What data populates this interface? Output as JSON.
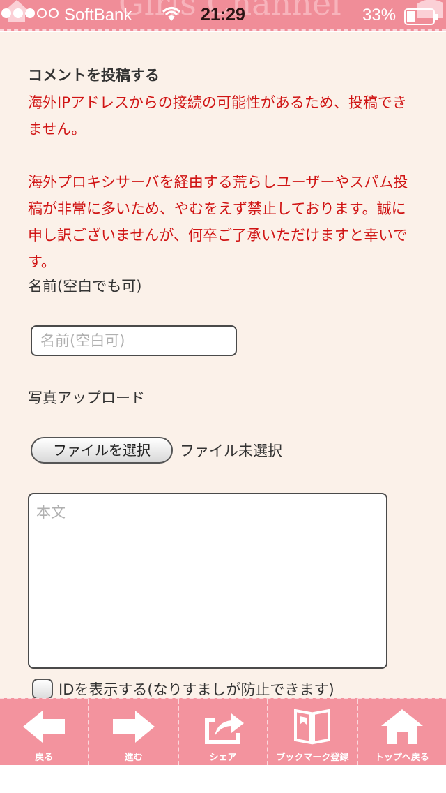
{
  "status_bar": {
    "carrier": "SoftBank",
    "time": "21:29",
    "battery_percent": "33%",
    "signal_bars_filled": 3,
    "signal_bars_total": 5
  },
  "header": {
    "site_title": "Girls Channel"
  },
  "form": {
    "title": "コメントを投稿する",
    "warning_1": "海外IPアドレスからの接続の可能性があるため、投稿できません。",
    "warning_2": "海外プロキシサーバを経由する荒らしユーザーやスパム投稿が非常に多いため、やむをえず禁止しております。誠に申し訳ございませんが、何卒ご了承いただけますと幸いです。",
    "name_label": "名前(空白でも可)",
    "name_placeholder": "名前(空白可)",
    "photo_label": "写真アップロード",
    "file_button_label": "ファイルを選択",
    "file_status": "ファイル未選択",
    "body_placeholder": "本文",
    "id_checkbox_label": "IDを表示する(なりすましが防止できます)",
    "id_checked": false
  },
  "toolbar": {
    "back": "戻る",
    "forward": "進む",
    "share": "シェア",
    "bookmark": "ブックマーク登録",
    "top": "トップへ戻る"
  },
  "colors": {
    "header_pink": "#f08d98",
    "toolbar_pink": "#f3939e",
    "warning_red": "#d01414",
    "content_bg": "#fbf1e9"
  }
}
